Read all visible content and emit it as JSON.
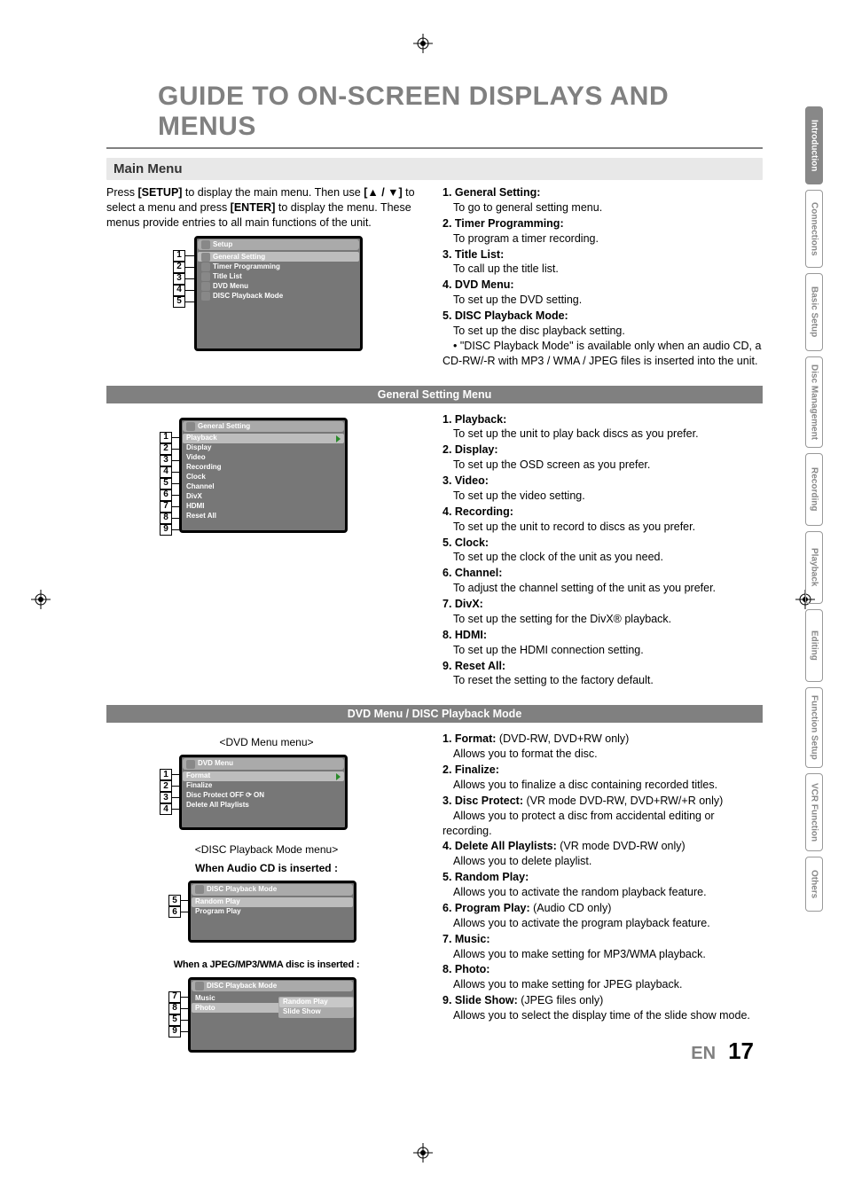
{
  "title": "GUIDE TO ON-SCREEN DISPLAYS AND MENUS",
  "main_menu_header": "Main Menu",
  "intro": {
    "p1a": "Press ",
    "setup_btn": "[SETUP]",
    "p1b": " to display the main menu. Then use ",
    "updown": "[▲ / ▼]",
    "p1c": " to select a menu and press ",
    "enter_btn": "[ENTER]",
    "p1d": " to display the menu. These menus provide entries to all main functions of the unit."
  },
  "main_menu_osd": {
    "title": "Setup",
    "items": [
      "General Setting",
      "Timer Programming",
      "Title List",
      "DVD Menu",
      "DISC Playback Mode"
    ]
  },
  "main_menu_desc": [
    {
      "lbl": "1. General Setting:",
      "txt": "To go to general setting menu."
    },
    {
      "lbl": "2. Timer Programming:",
      "txt": "To program a timer recording."
    },
    {
      "lbl": "3. Title List:",
      "txt": "To call up the title list."
    },
    {
      "lbl": "4. DVD Menu:",
      "txt": "To set up the DVD setting."
    },
    {
      "lbl": "5. DISC Playback Mode:",
      "txt": "To set up the disc playback setting.",
      "bullet": "• \"DISC Playback Mode\" is available only when an audio CD, a CD-RW/-R with MP3 / WMA / JPEG files is inserted into the unit."
    }
  ],
  "general_setting_header": "General Setting Menu",
  "general_osd": {
    "title": "General Setting",
    "items": [
      "Playback",
      "Display",
      "Video",
      "Recording",
      "Clock",
      "Channel",
      "DivX",
      "HDMI",
      "Reset All"
    ]
  },
  "general_desc": [
    {
      "lbl": "1. Playback:",
      "txt": "To set up the unit to play back discs as you prefer."
    },
    {
      "lbl": "2. Display:",
      "txt": "To set up the OSD screen as you prefer."
    },
    {
      "lbl": "3. Video:",
      "txt": "To set up the video setting."
    },
    {
      "lbl": "4. Recording:",
      "txt": "To set up the unit to record to discs as you prefer."
    },
    {
      "lbl": "5. Clock:",
      "txt": "To set up the clock of the unit as you need."
    },
    {
      "lbl": "6. Channel:",
      "txt": "To adjust the channel setting of the unit as you prefer."
    },
    {
      "lbl": "7. DivX:",
      "txt": "To set up the setting for the DivX® playback."
    },
    {
      "lbl": "8. HDMI:",
      "txt": "To set up the HDMI connection setting."
    },
    {
      "lbl": "9. Reset All:",
      "txt": "To reset the setting to the factory default."
    }
  ],
  "dvd_header": "DVD Menu / DISC Playback Mode",
  "dvd_menu_caption": "<DVD Menu menu>",
  "dvd_osd": {
    "title": "DVD Menu",
    "items": [
      "Format",
      "Finalize",
      "Disc Protect OFF ⟳ ON",
      "Delete All Playlists"
    ]
  },
  "disc_playback_caption": "<DISC Playback Mode menu>",
  "audio_cd_caption": "When Audio CD is inserted :",
  "disc_osd_audio": {
    "title": "DISC Playback Mode",
    "items": [
      "Random Play",
      "Program Play"
    ]
  },
  "jpeg_caption": "When a JPEG/MP3/WMA disc is inserted :",
  "disc_osd_jpeg": {
    "title": "DISC Playback Mode",
    "items": [
      "Music",
      "Photo"
    ],
    "submenu": [
      "Random Play",
      "Slide Show"
    ]
  },
  "dvd_desc": [
    {
      "lbl": "1. Format:",
      "after": " (DVD-RW, DVD+RW only)",
      "txt": "Allows you to format the disc."
    },
    {
      "lbl": "2. Finalize:",
      "txt": "Allows you to finalize a disc containing recorded titles."
    },
    {
      "lbl": "3. Disc Protect:",
      "after": " (VR mode DVD-RW, DVD+RW/+R only)",
      "txt": "Allows you to protect a disc from accidental editing or recording."
    },
    {
      "lbl": "4. Delete All Playlists:",
      "after": " (VR mode DVD-RW only)",
      "txt": "Allows you to delete playlist."
    },
    {
      "lbl": "5. Random Play:",
      "txt": "Allows you to activate the random playback feature."
    },
    {
      "lbl": "6. Program Play:",
      "after": " (Audio CD only)",
      "txt": "Allows you to activate the program playback feature."
    },
    {
      "lbl": "7. Music:",
      "txt": "Allows you to make setting for MP3/WMA playback."
    },
    {
      "lbl": "8. Photo:",
      "txt": "Allows you to make setting for JPEG playback."
    },
    {
      "lbl": "9. Slide Show:",
      "after": " (JPEG files only)",
      "txt": "Allows you to select the display time of the slide show mode."
    }
  ],
  "tabs": [
    "Introduction",
    "Connections",
    "Basic Setup",
    "Disc Management",
    "Recording",
    "Playback",
    "Editing",
    "Function Setup",
    "VCR Function",
    "Others"
  ],
  "page_lang": "EN",
  "page_number": "17",
  "callout_nums": {
    "setup": [
      "1",
      "2",
      "3",
      "4",
      "5"
    ],
    "general": [
      "1",
      "2",
      "3",
      "4",
      "5",
      "6",
      "7",
      "8",
      "9"
    ],
    "dvd": [
      "1",
      "2",
      "3",
      "4"
    ],
    "audio": [
      "5",
      "6"
    ],
    "jpeg": [
      "7",
      "8",
      "5",
      "9"
    ]
  }
}
